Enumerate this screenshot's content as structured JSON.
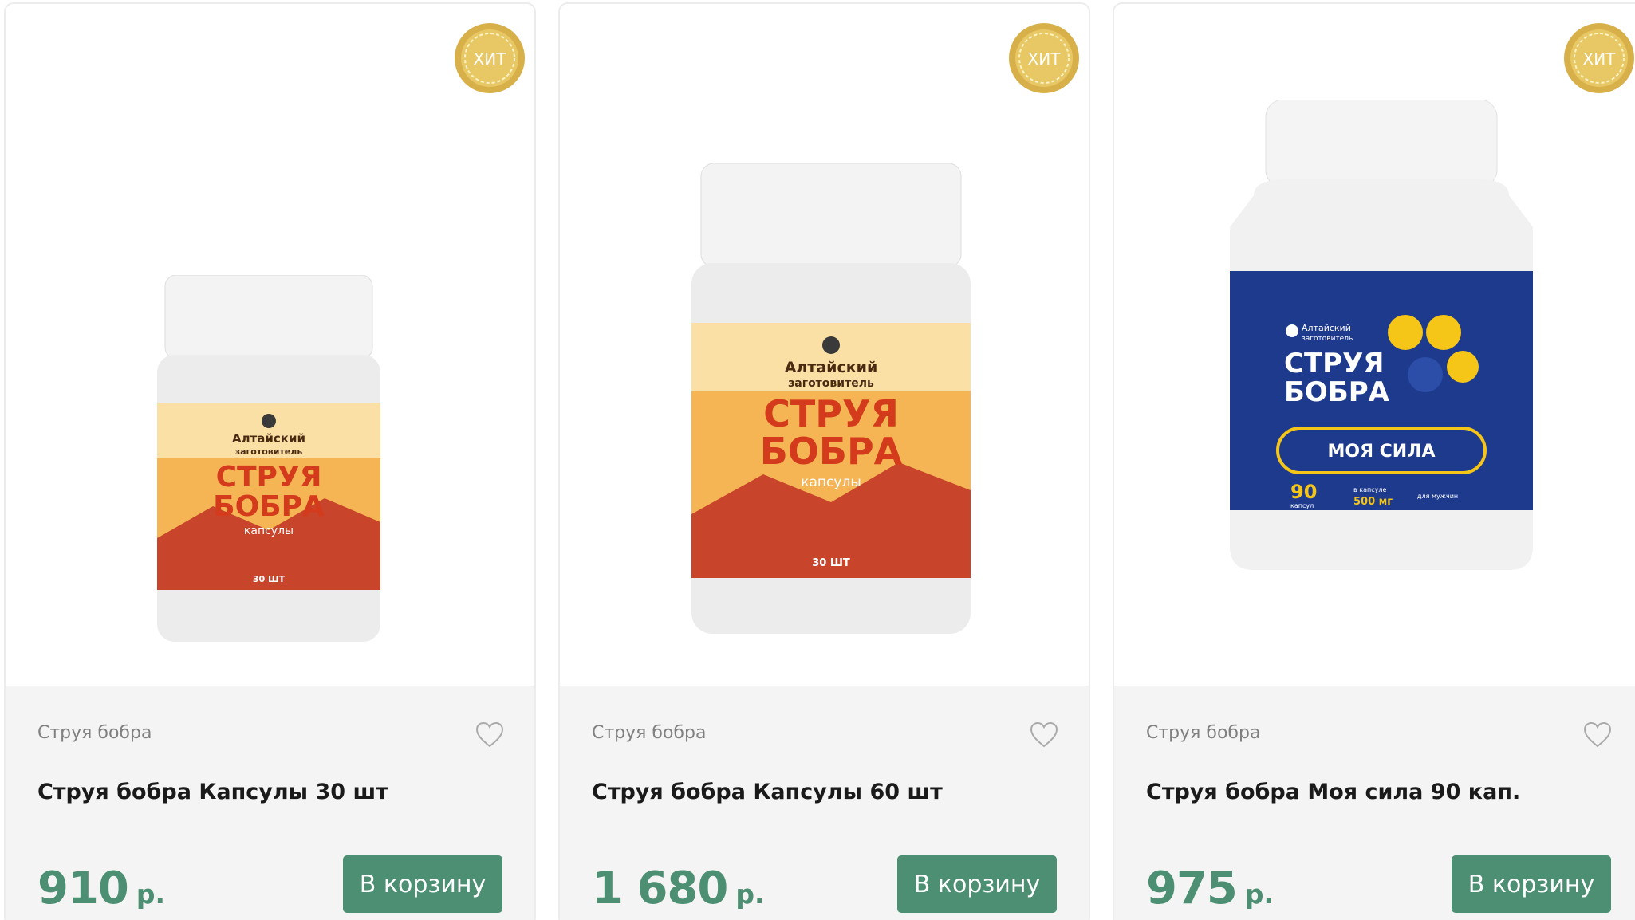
{
  "products": [
    {
      "badge": "ХИТ",
      "category": "Струя бобра",
      "title": "Струя бобра Капсулы 30 шт",
      "price": "910",
      "currency": "р.",
      "button": "В корзину",
      "jar": {
        "brand_line1": "Алтайский",
        "brand_line2": "заготовитель",
        "name_line1": "СТРУЯ",
        "name_line2": "БОБРА",
        "form": "капсулы",
        "count": "30 ШТ"
      }
    },
    {
      "badge": "ХИТ",
      "category": "Струя бобра",
      "title": "Струя бобра Капсулы 60 шт",
      "price": "1 680",
      "currency": "р.",
      "button": "В корзину",
      "jar": {
        "brand_line1": "Алтайский",
        "brand_line2": "заготовитель",
        "name_line1": "СТРУЯ",
        "name_line2": "БОБРА",
        "form": "капсулы",
        "count": "30 ШТ"
      }
    },
    {
      "badge": "ХИТ",
      "category": "Струя бобра",
      "title": "Струя бобра Моя сила 90 кап.",
      "price": "975",
      "currency": "р.",
      "button": "В корзину",
      "jar": {
        "brand_line1": "Алтайский",
        "brand_line2": "заготовитель",
        "name_line1": "СТРУЯ",
        "name_line2": "БОБРА",
        "subline": "МОЯ СИЛА",
        "count": "90",
        "count_unit": "капсул",
        "dose": "500 мг",
        "dose_label": "в капсуле",
        "target": "для мужчин"
      }
    }
  ],
  "colors": {
    "accent": "#4c8f72",
    "info_bg": "#f4f4f4",
    "badge_gold": "#d8b04a",
    "blue_label": "#1e3a8c",
    "orange_label": "#f08a1e"
  },
  "icons": {
    "favorite": "heart-outline-icon",
    "badge": "laurel-medal-icon"
  }
}
